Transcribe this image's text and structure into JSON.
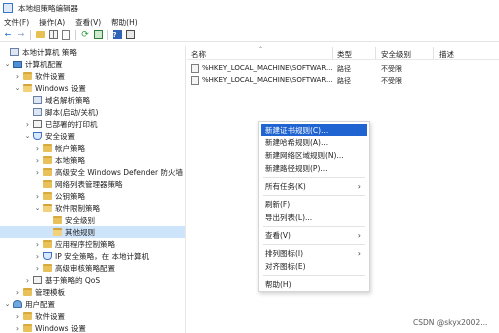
{
  "window": {
    "title": "本地组策略编辑器"
  },
  "menu": [
    "文件(F)",
    "操作(A)",
    "查看(V)",
    "帮助(H)"
  ],
  "tree": [
    {
      "label": "本地计算机 策略",
      "arrow": "none",
      "icon": "computer-policy-icon"
    },
    {
      "label": "计算机配置",
      "arrow": "down",
      "icon": "computer-icon"
    },
    {
      "label": "软件设置",
      "arrow": "right",
      "icon": "folder-icon"
    },
    {
      "label": "Windows 设置",
      "arrow": "down",
      "icon": "folder-icon"
    },
    {
      "label": "域名解析策略",
      "arrow": "none",
      "icon": "policy-icon"
    },
    {
      "label": "脚本(启动/关机)",
      "arrow": "none",
      "icon": "script-icon"
    },
    {
      "label": "已部署的打印机",
      "arrow": "right",
      "icon": "printer-icon"
    },
    {
      "label": "安全设置",
      "arrow": "down",
      "icon": "security-icon"
    },
    {
      "label": "帐户策略",
      "arrow": "right",
      "icon": "folder-icon"
    },
    {
      "label": "本地策略",
      "arrow": "right",
      "icon": "folder-icon"
    },
    {
      "label": "高级安全 Windows Defender 防火墙",
      "arrow": "right",
      "icon": "folder-icon"
    },
    {
      "label": "网络列表管理器策略",
      "arrow": "none",
      "icon": "folder-icon"
    },
    {
      "label": "公钥策略",
      "arrow": "right",
      "icon": "folder-icon"
    },
    {
      "label": "软件限制策略",
      "arrow": "down",
      "icon": "folder-open-icon"
    },
    {
      "label": "安全级别",
      "arrow": "none",
      "icon": "folder-icon"
    },
    {
      "label": "其他规则",
      "arrow": "none",
      "icon": "folder-open-icon",
      "selected": true
    },
    {
      "label": "应用程序控制策略",
      "arrow": "right",
      "icon": "folder-icon"
    },
    {
      "label": "IP 安全策略，在 本地计算机",
      "arrow": "right",
      "icon": "ip-security-icon"
    },
    {
      "label": "高级审核策略配置",
      "arrow": "right",
      "icon": "folder-icon"
    },
    {
      "label": "基于策略的 QoS",
      "arrow": "right",
      "icon": "chart-icon"
    },
    {
      "label": "管理模板",
      "arrow": "right",
      "icon": "folder-icon"
    },
    {
      "label": "用户配置",
      "arrow": "down",
      "icon": "user-icon"
    },
    {
      "label": "软件设置",
      "arrow": "right",
      "icon": "folder-icon"
    },
    {
      "label": "Windows 设置",
      "arrow": "right",
      "icon": "folder-icon"
    }
  ],
  "list": {
    "columns": [
      "名称",
      "类型",
      "安全级别",
      "描述"
    ],
    "rows": [
      {
        "name": "%HKEY_LOCAL_MACHINE\\SOFTWAR...",
        "type": "路径",
        "level": "不受限",
        "desc": ""
      },
      {
        "name": "%HKEY_LOCAL_MACHINE\\SOFTWAR...",
        "type": "路径",
        "level": "不受限",
        "desc": ""
      }
    ]
  },
  "context_menu": [
    {
      "label": "新建证书规则(C)...",
      "highlight": true
    },
    {
      "label": "新建哈希规则(A)..."
    },
    {
      "label": "新建网络区域规则(N)..."
    },
    {
      "label": "新建路径规则(P)..."
    },
    {
      "sep": true
    },
    {
      "label": "所有任务(K)",
      "submenu": true
    },
    {
      "sep": true
    },
    {
      "label": "刷新(F)"
    },
    {
      "label": "导出列表(L)..."
    },
    {
      "sep": true
    },
    {
      "label": "查看(V)",
      "submenu": true
    },
    {
      "sep": true
    },
    {
      "label": "排列图标(I)",
      "submenu": true
    },
    {
      "label": "对齐图标(E)"
    },
    {
      "sep": true
    },
    {
      "label": "帮助(H)"
    }
  ],
  "watermark": "CSDN @skyx2002..."
}
